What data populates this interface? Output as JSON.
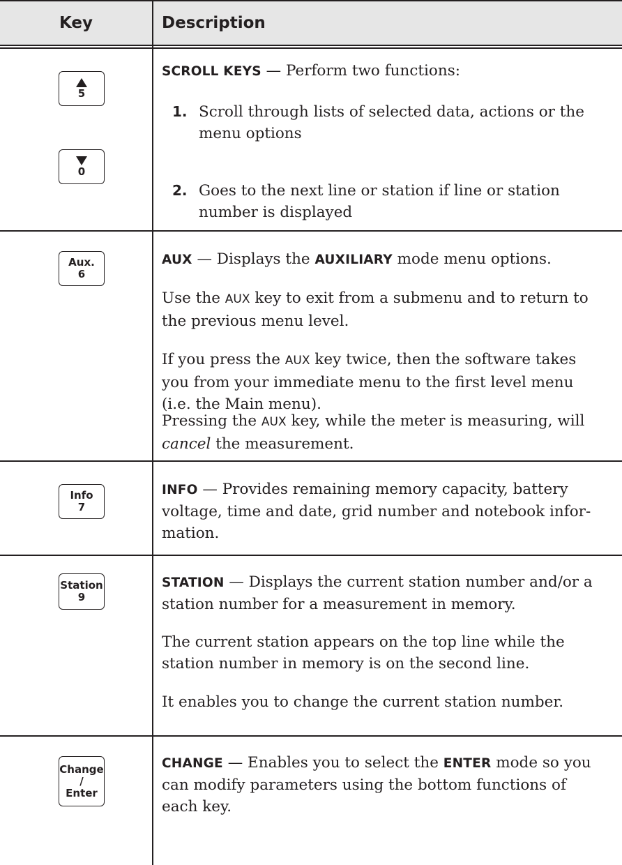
{
  "header": {
    "col_key": "Key",
    "col_description": "Description"
  },
  "rows": [
    {
      "keys": [
        {
          "icon": "arrow-up-triangle",
          "label": "5"
        },
        {
          "icon": "arrow-down-triangle",
          "label": "0"
        }
      ],
      "term": "SCROLL KEYS",
      "lead": " — Perform two functions:",
      "items": [
        {
          "num": "1.",
          "text": "Scroll through lists of selected data, actions or the menu options"
        },
        {
          "num": "2.",
          "text": "Goes to the next line or station if line or station number is displayed"
        }
      ]
    },
    {
      "key": {
        "line1": "Aux.",
        "line2": "6"
      },
      "term": "AUX",
      "lead_a": " — Displays the ",
      "term2": "AUXILIARY",
      "lead_b": " mode menu options.",
      "p2_a": "Use the ",
      "p2_key": "AUX",
      "p2_b": " key to exit from a submenu and to return to the previous menu level.",
      "p3_a": "If you press the ",
      "p3_key": "AUX",
      "p3_b": " key twice, then the software takes you from your immediate menu to the first level menu (i.e. the Main menu).",
      "p4_a": "Pressing the ",
      "p4_key": "AUX",
      "p4_b": " key, while the meter is measuring, will ",
      "p4_em": "cancel",
      "p4_c": " the measurement."
    },
    {
      "key": {
        "line1": "Info",
        "line2": "7"
      },
      "term": "INFO",
      "lead": " — Provides remaining memory capacity, battery voltage, time and date, grid number and notebook infor-mation."
    },
    {
      "key": {
        "line1": "Station",
        "line2": "9"
      },
      "term": "STATION",
      "lead": " — Displays the current station number and/or a station number for a measurement in memory.",
      "p2": "The current station appears on the top line while the station number in memory is on the second line.",
      "p3": "It enables you to change the current station number."
    },
    {
      "key": {
        "line1": "Change",
        "line2": "/",
        "line3": "Enter"
      },
      "term": "CHANGE",
      "lead_a": " — Enables you to select the ",
      "term2": "ENTER",
      "lead_b": " mode so you can modify parameters using the bottom functions of each key."
    }
  ]
}
